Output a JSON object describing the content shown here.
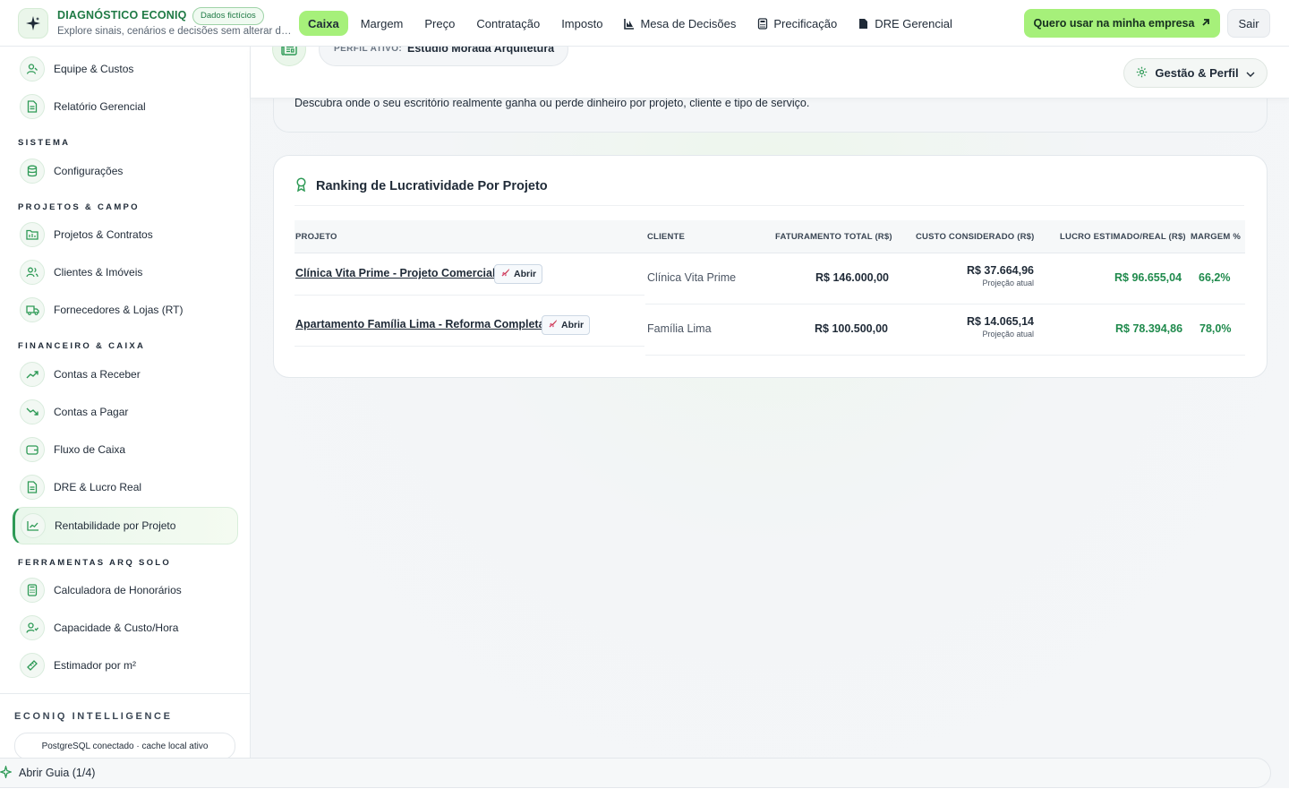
{
  "brand": {
    "title": "DIAGNÓSTICO ECONIQ",
    "badge": "Dados fictícios",
    "subtitle": "Explore sinais, cenários e decisões sem alterar dados reais."
  },
  "nav": {
    "items": [
      {
        "label": "Caixa",
        "active": true
      },
      {
        "label": "Margem"
      },
      {
        "label": "Preço"
      },
      {
        "label": "Contratação"
      },
      {
        "label": "Imposto"
      },
      {
        "label": "Mesa de Decisões",
        "icon": "chart-icon"
      },
      {
        "label": "Precificação",
        "icon": "calculator-icon"
      },
      {
        "label": "DRE Gerencial",
        "icon": "document-icon"
      }
    ],
    "cta_label": "Quero usar na minha empresa",
    "logout_label": "Sair"
  },
  "sidebar": {
    "top_items": [
      {
        "label": "Equipe & Custos",
        "icon": "user-icon"
      },
      {
        "label": "Relatório Gerencial",
        "icon": "file-icon"
      }
    ],
    "sections": [
      {
        "title": "SISTEMA",
        "items": [
          {
            "label": "Configurações",
            "icon": "database-icon"
          }
        ]
      },
      {
        "title": "PROJETOS & CAMPO",
        "items": [
          {
            "label": "Projetos & Contratos",
            "icon": "folder-icon"
          },
          {
            "label": "Clientes & Imóveis",
            "icon": "users-icon"
          },
          {
            "label": "Fornecedores & Lojas (RT)",
            "icon": "truck-icon"
          }
        ]
      },
      {
        "title": "FINANCEIRO & CAIXA",
        "items": [
          {
            "label": "Contas a Receber",
            "icon": "trend-up-icon"
          },
          {
            "label": "Contas a Pagar",
            "icon": "trend-down-icon"
          },
          {
            "label": "Fluxo de Caixa",
            "icon": "wallet-icon"
          },
          {
            "label": "DRE & Lucro Real",
            "icon": "file-icon"
          },
          {
            "label": "Rentabilidade por Projeto",
            "icon": "line-chart-icon",
            "active": true
          }
        ]
      },
      {
        "title": "FERRAMENTAS ARQ SOLO",
        "items": [
          {
            "label": "Calculadora de Honorários",
            "icon": "calculator-icon"
          },
          {
            "label": "Capacidade & Custo/Hora",
            "icon": "user-clock-icon"
          },
          {
            "label": "Estimador por m²",
            "icon": "ruler-icon"
          }
        ]
      }
    ],
    "intelligence_title": "ECONIQ INTELLIGENCE",
    "intelligence_status": "PostgreSQL conectado · cache local ativo"
  },
  "profile": {
    "label": "PERFIL ATIVO:",
    "value": "Estúdio Morada Arquitetura"
  },
  "gestao_label": "Gestão & Perfil",
  "hero": {
    "description": "Descubra onde o seu escritório realmente ganha ou perde dinheiro por projeto, cliente e tipo de serviço."
  },
  "ranking": {
    "title": "Ranking de Lucratividade Por Projeto",
    "columns": {
      "project": "PROJETO",
      "client": "CLIENTE",
      "revenue": "FATURAMENTO TOTAL (R$)",
      "cost": "CUSTO CONSIDERADO (R$)",
      "profit": "LUCRO ESTIMADO/REAL (R$)",
      "margin": "MARGEM %"
    },
    "open_label": "Abrir",
    "rows": [
      {
        "project": "Clínica Vita Prime - Projeto Comercial",
        "client": "Clínica Vita Prime",
        "revenue": "R$ 146.000,00",
        "cost": "R$ 37.664,96",
        "cost_note": "Projeção atual",
        "profit": "R$ 96.655,04",
        "margin": "66,2%"
      },
      {
        "project": "Apartamento Família Lima - Reforma Completa",
        "client": "Família Lima",
        "revenue": "R$ 100.500,00",
        "cost": "R$ 14.065,14",
        "cost_note": "Projeção atual",
        "profit": "R$ 78.394,86",
        "margin": "78,0%"
      }
    ]
  },
  "guide": {
    "label": "Abrir Guia (1/4)"
  },
  "colors": {
    "accent": "#a6f07a",
    "brand_green": "#1f7a45",
    "positive": "#1f8a4c"
  }
}
